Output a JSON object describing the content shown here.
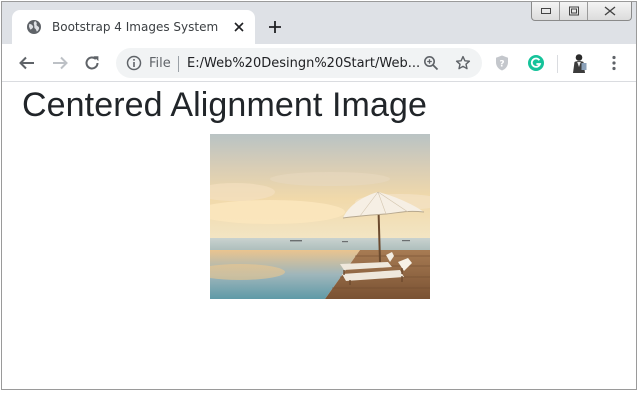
{
  "browser": {
    "tab": {
      "title": "Bootstrap 4 Images System",
      "favicon": "globe-icon"
    },
    "address_bar": {
      "security_label": "File",
      "url": "E:/Web%20Desingn%20Start/Web..."
    },
    "toolbar_icons": [
      "back-arrow-icon",
      "forward-arrow-icon",
      "reload-icon",
      "zoom-icon",
      "star-icon",
      "shield-extension-icon",
      "grammarly-icon",
      "profile-avatar",
      "more-menu-icon"
    ]
  },
  "page": {
    "heading": "Centered Alignment Image",
    "image": {
      "subject": "beach-umbrella-sunloungers-photo"
    }
  },
  "colors": {
    "tab_strip": "#dee1e6",
    "omnibox": "#f1f3f4",
    "heading_text": "#212529",
    "grammarly_green": "#15c39a"
  }
}
